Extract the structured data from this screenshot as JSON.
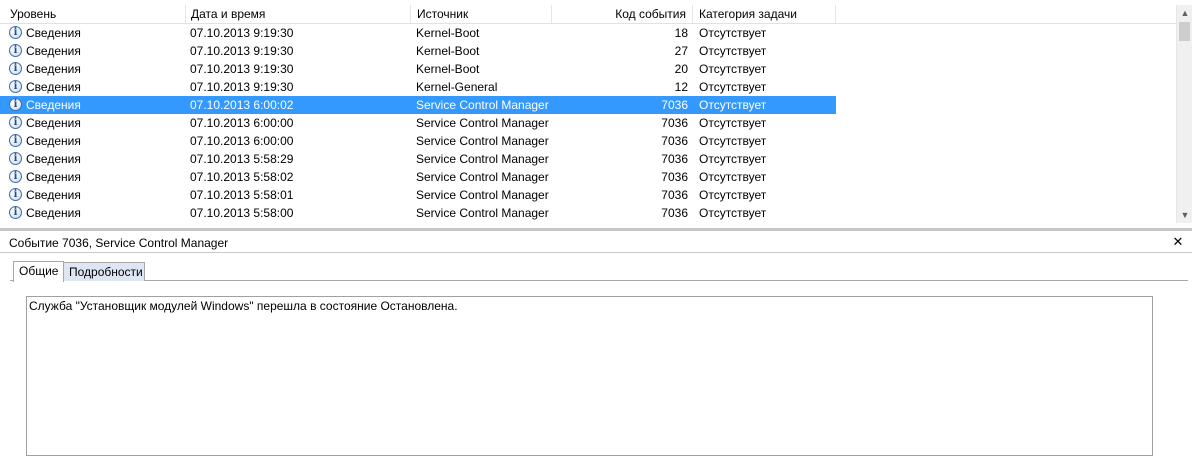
{
  "columns": {
    "level": "Уровень",
    "datetime": "Дата и время",
    "source": "Источник",
    "event_code": "Код события",
    "category": "Категория задачи"
  },
  "icons": {
    "level_icon": "info-icon",
    "level_icon_glyph": "i",
    "close_glyph": "✕"
  },
  "colors": {
    "selection": "#3399ff"
  },
  "events": [
    {
      "level": "Сведения",
      "datetime": "07.10.2013 9:19:30",
      "source": "Kernel-Boot",
      "code": "18",
      "category": "Отсутствует"
    },
    {
      "level": "Сведения",
      "datetime": "07.10.2013 9:19:30",
      "source": "Kernel-Boot",
      "code": "27",
      "category": "Отсутствует"
    },
    {
      "level": "Сведения",
      "datetime": "07.10.2013 9:19:30",
      "source": "Kernel-Boot",
      "code": "20",
      "category": "Отсутствует"
    },
    {
      "level": "Сведения",
      "datetime": "07.10.2013 9:19:30",
      "source": "Kernel-General",
      "code": "12",
      "category": "Отсутствует"
    },
    {
      "level": "Сведения",
      "datetime": "07.10.2013 6:00:02",
      "source": "Service Control Manager",
      "code": "7036",
      "category": "Отсутствует"
    },
    {
      "level": "Сведения",
      "datetime": "07.10.2013 6:00:00",
      "source": "Service Control Manager",
      "code": "7036",
      "category": "Отсутствует"
    },
    {
      "level": "Сведения",
      "datetime": "07.10.2013 6:00:00",
      "source": "Service Control Manager",
      "code": "7036",
      "category": "Отсутствует"
    },
    {
      "level": "Сведения",
      "datetime": "07.10.2013 5:58:29",
      "source": "Service Control Manager",
      "code": "7036",
      "category": "Отсутствует"
    },
    {
      "level": "Сведения",
      "datetime": "07.10.2013 5:58:02",
      "source": "Service Control Manager",
      "code": "7036",
      "category": "Отсутствует"
    },
    {
      "level": "Сведения",
      "datetime": "07.10.2013 5:58:01",
      "source": "Service Control Manager",
      "code": "7036",
      "category": "Отсутствует"
    },
    {
      "level": "Сведения",
      "datetime": "07.10.2013 5:58:00",
      "source": "Service Control Manager",
      "code": "7036",
      "category": "Отсутствует"
    }
  ],
  "selected_index": 4,
  "detail": {
    "title": "Событие 7036, Service Control Manager",
    "tabs": [
      "Общие",
      "Подробности"
    ],
    "active_tab": "Общие",
    "description": "Служба \"Установщик модулей Windows\" перешла в состояние Остановлена."
  }
}
